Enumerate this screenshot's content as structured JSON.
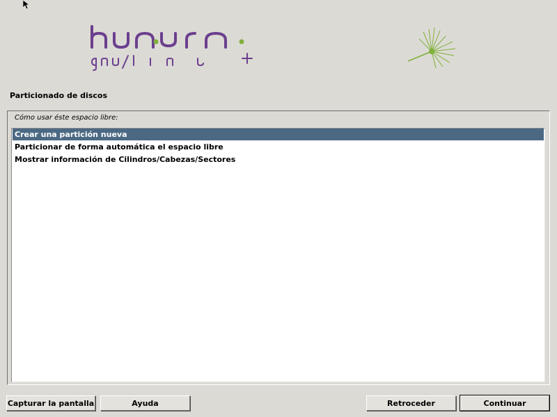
{
  "branding": {
    "logo_line1": "huayra",
    "logo_line2": "gnu/linux",
    "logo_plus": "+",
    "accent_color": "#6b3f8e",
    "leaf_color": "#7fb13a"
  },
  "page": {
    "title": "Particionado de discos",
    "prompt": "Cómo usar éste espacio libre:"
  },
  "options": [
    {
      "label": "Crear una partición nueva",
      "selected": true
    },
    {
      "label": "Particionar de forma automática el espacio libre",
      "selected": false
    },
    {
      "label": "Mostrar información de Cilindros/Cabezas/Sectores",
      "selected": false
    }
  ],
  "buttons": {
    "screenshot": "Capturar la pantalla",
    "help": "Ayuda",
    "back": "Retroceder",
    "continue": "Continuar"
  },
  "colors": {
    "background": "#dcdad5",
    "selection": "#4b6983"
  }
}
